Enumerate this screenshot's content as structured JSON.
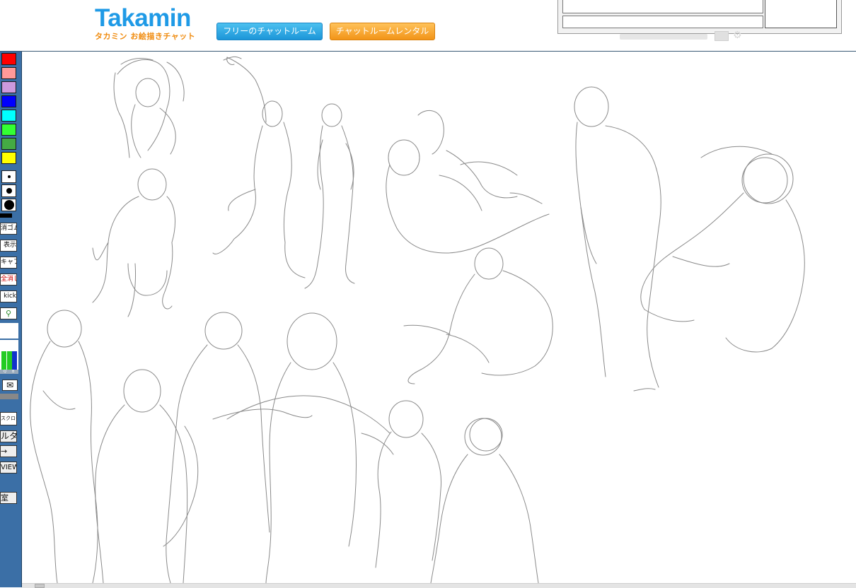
{
  "header": {
    "logo_title": "Takamin",
    "logo_subtitle": "タカミン お絵描きチャット",
    "free_room_button": "フリーのチャットルーム",
    "rental_button": "チャットルームレンタル"
  },
  "toolbar": {
    "colors": [
      {
        "name": "red",
        "hex": "#ff0000"
      },
      {
        "name": "pink",
        "hex": "#ff9999"
      },
      {
        "name": "lavender",
        "hex": "#cc99dd"
      },
      {
        "name": "blue",
        "hex": "#0000ff"
      },
      {
        "name": "cyan",
        "hex": "#00ffff"
      },
      {
        "name": "light-green",
        "hex": "#33ff33"
      },
      {
        "name": "green",
        "hex": "#44aa44"
      },
      {
        "name": "yellow",
        "hex": "#ffff00"
      }
    ],
    "pen_sizes": [
      "small",
      "medium",
      "large"
    ],
    "eraser_label": "消ゴム",
    "display_label": "表示",
    "capture_label": "キャプ",
    "clear_all_label": "全消し",
    "kick_label": "kick",
    "scroll_label": "スクロール",
    "karuta_label": "ルタ",
    "arrow_label": "→",
    "view_label": "VIEW",
    "room_label": "室",
    "meter_labels": [
      "Q",
      "B"
    ]
  },
  "colors": {
    "header_border": "#3a5a74",
    "toolbar_bg": "#3b6fa6",
    "sketch_stroke": "#8a8a8a",
    "logo_blue": "#1f9ae6",
    "logo_orange": "#f08c10"
  }
}
